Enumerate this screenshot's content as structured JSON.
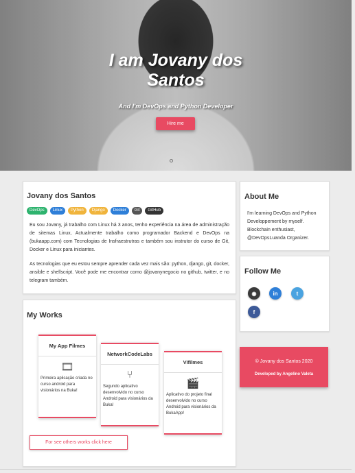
{
  "hero": {
    "title_line1": "I am Jovany dos",
    "title_line2": "Santos",
    "subtitle": "And I'm DevOps and Python Developer",
    "hire_label": "Hire me"
  },
  "about": {
    "name": "Jovany dos Santos",
    "badges": [
      {
        "label": "DevOps",
        "color": "#2eb36e"
      },
      {
        "label": "Linux",
        "color": "#2f7fd8"
      },
      {
        "label": "Python",
        "color": "#f0b43c"
      },
      {
        "label": "Django",
        "color": "#f0b43c"
      },
      {
        "label": "Docker",
        "color": "#2f7fd8"
      },
      {
        "label": "Git",
        "color": "#555555"
      },
      {
        "label": "GitHub",
        "color": "#333333"
      }
    ],
    "paragraph1": "Eu sou Jovany, já trabalho com Linux há 3 anos, tenho experiência na área de administração de sitemas Linux, Actualmente trabalho como programador Backend e DevOps na (bukaapp.com) com Tecnologias de Insfraestrutras e também sou instrutor do curso de Git, Docker e Linux para iniciantes.",
    "paragraph2": "As tecnologias que eu estou sempre aprender cada vez mais são: python, django, git, docker, ansible e shellscript. Você pode me encontrar como @jovanynegocio no github, twitter, e no telegram também."
  },
  "works": {
    "title": "My Works",
    "items": [
      {
        "title": "My App Filmes",
        "icon": "film-icon",
        "glyph": "🎞",
        "desc": "Primeira aplicação criada no curso android para visionários na Buka!"
      },
      {
        "title": "NetworkCodeLabs",
        "icon": "fork-icon",
        "glyph": "⑂",
        "desc": "Segundo aplicativo desenvolvido no curso Android para visionários da Buka!"
      },
      {
        "title": "Vifilmes",
        "icon": "clapper-icon",
        "glyph": "🎬",
        "desc": "Aplicativo do projeto final desenvolvido no curso Android para visionários da BukaApp!"
      }
    ],
    "more_label": "For see others works click here"
  },
  "sidebar": {
    "about_title": "About Me",
    "about_text": "I'm learning DevOps and Python Developpement by myself. Blockchain enthusiast, @DevOpsLuanda Organizer.",
    "follow_title": "Follow Me",
    "socials": [
      {
        "name": "github-icon",
        "glyph": "◉",
        "bg": "#3a3a3a"
      },
      {
        "name": "linkedin-icon",
        "glyph": "in",
        "bg": "#2f7fd8"
      },
      {
        "name": "twitter-icon",
        "glyph": "t",
        "bg": "#4aa3e0"
      },
      {
        "name": "facebook-icon",
        "glyph": "f",
        "bg": "#3d5a98"
      }
    ]
  },
  "footer": {
    "copyright": "© Jovany dos Santos 2020",
    "developer": "Developed by Angelino Valeta"
  },
  "colors": {
    "accent": "#e84a62"
  }
}
